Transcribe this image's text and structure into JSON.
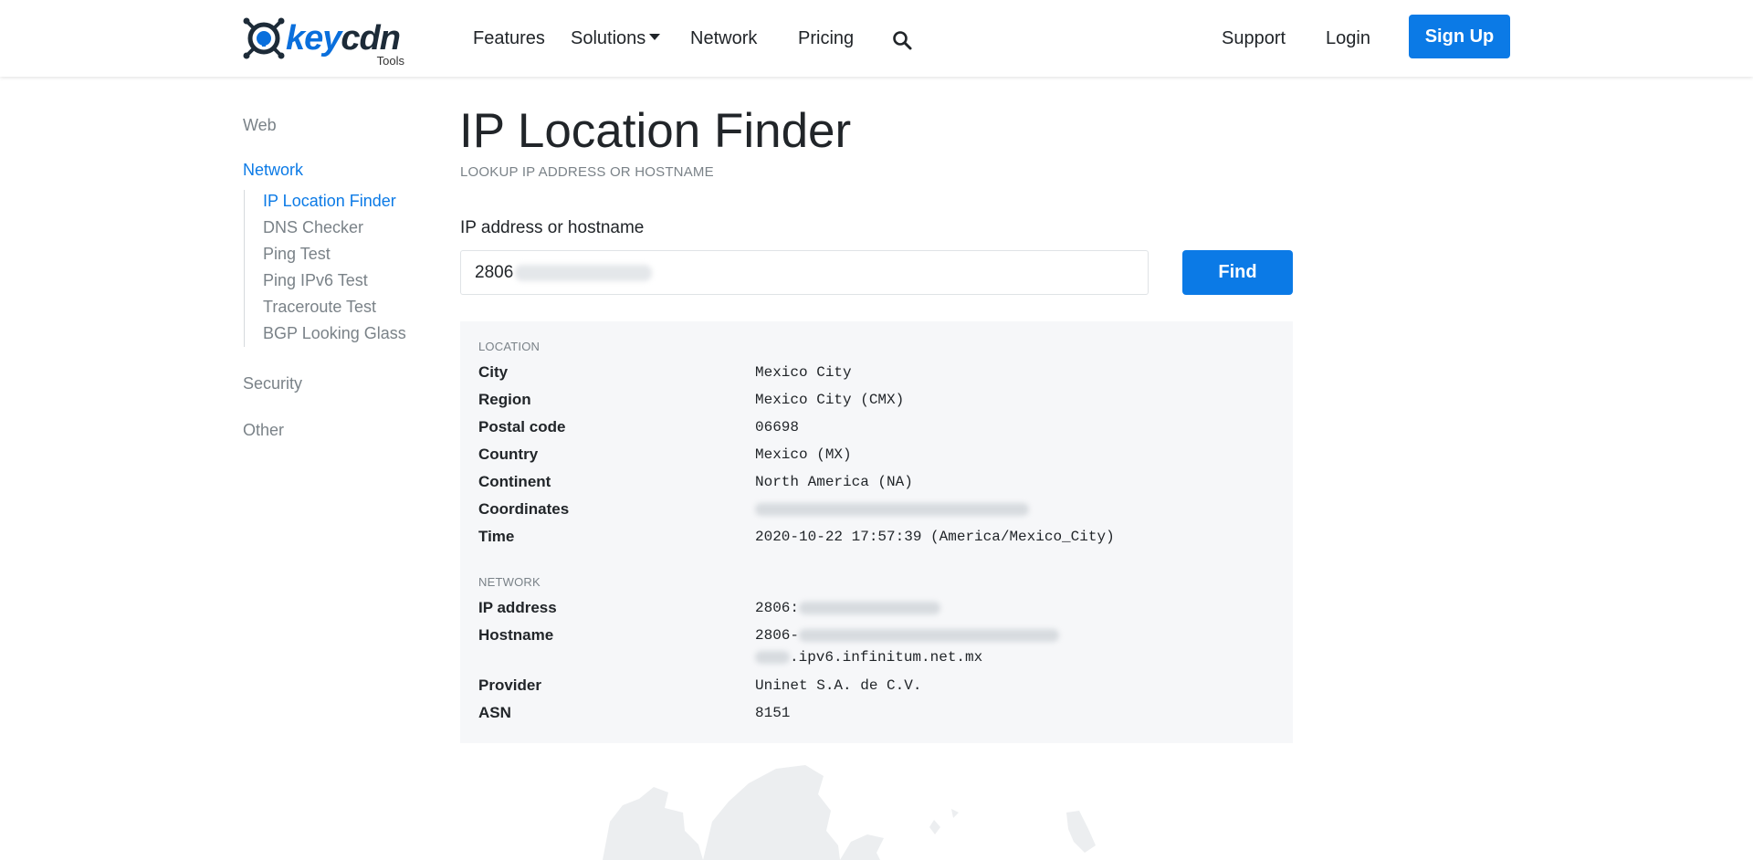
{
  "brand": {
    "name_key": "key",
    "name_cdn": "cdn",
    "sub": "Tools"
  },
  "nav": {
    "features": "Features",
    "solutions": "Solutions",
    "network": "Network",
    "pricing": "Pricing",
    "support": "Support",
    "login": "Login",
    "signup": "Sign Up"
  },
  "sidebar": {
    "web": "Web",
    "network": "Network",
    "items": [
      {
        "label": "IP Location Finder"
      },
      {
        "label": "DNS Checker"
      },
      {
        "label": "Ping Test"
      },
      {
        "label": "Ping IPv6 Test"
      },
      {
        "label": "Traceroute Test"
      },
      {
        "label": "BGP Looking Glass"
      }
    ],
    "security": "Security",
    "other": "Other"
  },
  "page": {
    "title": "IP Location Finder",
    "subtitle": "LOOKUP IP ADDRESS OR HOSTNAME",
    "input_label": "IP address or hostname",
    "input_value": "2806",
    "find": "Find"
  },
  "location": {
    "heading": "LOCATION",
    "city_label": "City",
    "city": "Mexico City",
    "region_label": "Region",
    "region": "Mexico City (CMX)",
    "postal_label": "Postal code",
    "postal": "06698",
    "country_label": "Country",
    "country": "Mexico (MX)",
    "continent_label": "Continent",
    "continent": "North America (NA)",
    "coords_label": "Coordinates",
    "time_label": "Time",
    "time": "2020-10-22 17:57:39 (America/Mexico_City)"
  },
  "network": {
    "heading": "NETWORK",
    "ip_label": "IP address",
    "ip_prefix": "2806:",
    "host_label": "Hostname",
    "host_prefix": "2806-",
    "host_suffix": ".ipv6.infinitum.net.mx",
    "provider_label": "Provider",
    "provider": "Uninet S.A. de C.V.",
    "asn_label": "ASN",
    "asn": "8151"
  },
  "colors": {
    "accent": "#0b7ae6",
    "panel": "#f6f7f9",
    "muted": "#7a8288"
  }
}
